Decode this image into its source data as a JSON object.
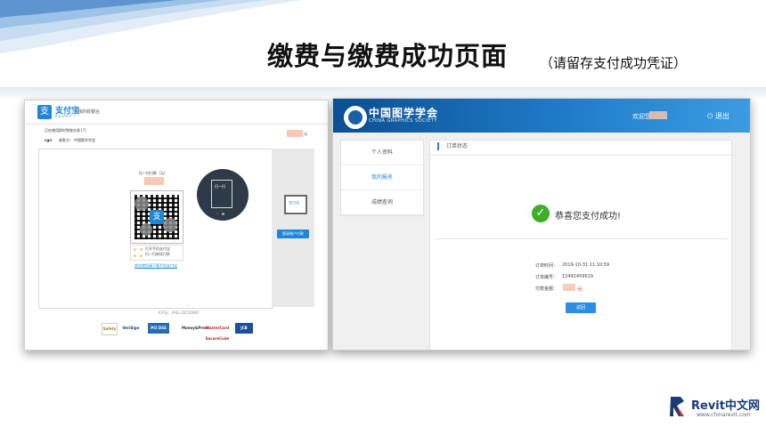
{
  "slide": {
    "title": "缴费与缴费成功页面",
    "subtitle": "（请留存支付成功凭证）"
  },
  "alipay": {
    "brand": "支付宝",
    "brand_en": "ALIPAY",
    "cashier": "我的收银台",
    "order_line": "正在使用即时到账交易 [?]",
    "payee_abbr": "cgn",
    "payee_label": "收款方：",
    "payee_name": "中国图学学会",
    "amount_suffix": "元",
    "qr_amount_label": "扫一扫付款（元）",
    "scan_hint_1": "打开手机支付宝",
    "scan_hint_2": "扫一扫继续付款",
    "phone_label": "扫一扫",
    "qr_link": "首次使用请下载手机支付宝",
    "pc_label": "支付宝",
    "pc_button": "登录账户付款",
    "footer": "ICP证：沪B2-20150087",
    "badges": [
      "Safety",
      "VeriSign",
      "PCI DSS",
      "Money&Press",
      "MasterCard SecureCode",
      "JCB J/Secure"
    ]
  },
  "society": {
    "name_cn": "中国图学学会",
    "name_en": "CHINA GRAPHICS SOCIETY",
    "welcome": "欢迎您",
    "logout": "退出",
    "nav": [
      "个人资料",
      "我的报名",
      "成绩查询"
    ],
    "tab": "订单状态",
    "success": "恭喜您支付成功!",
    "order_time_label": "订单时间：",
    "order_time": "2019-10-31 11:10:59",
    "order_no_label": "订单编号：",
    "order_no": "12491459619",
    "amount_label": "付款金额：",
    "amount_unit": "元",
    "return_button": "返回"
  },
  "watermark": {
    "brand": "Revit中文网",
    "url": "www.chinarevit.com"
  }
}
